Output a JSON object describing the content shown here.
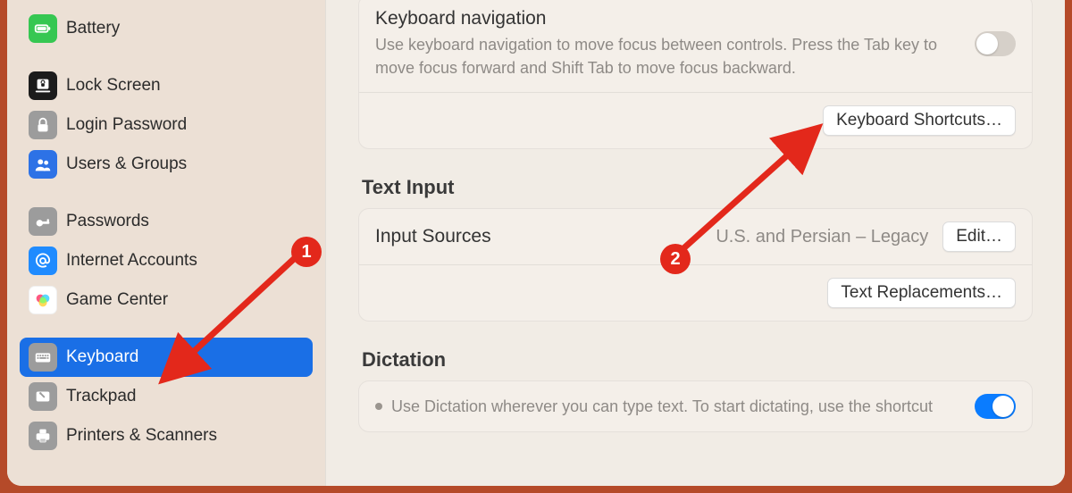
{
  "sidebar": {
    "items": [
      {
        "label": "Battery",
        "icon": "battery",
        "iconBg": "#36c752",
        "selected": false
      },
      {
        "label": "Lock Screen",
        "icon": "lock-screen",
        "iconBg": "#1c1c1c",
        "selected": false
      },
      {
        "label": "Login Password",
        "icon": "lock",
        "iconBg": "#9c9c9c",
        "selected": false
      },
      {
        "label": "Users & Groups",
        "icon": "users",
        "iconBg": "#2d72e6",
        "selected": false
      },
      {
        "label": "Passwords",
        "icon": "key",
        "iconBg": "#9c9c9c",
        "selected": false
      },
      {
        "label": "Internet Accounts",
        "icon": "at",
        "iconBg": "#1f8bff",
        "selected": false
      },
      {
        "label": "Game Center",
        "icon": "game-center",
        "iconBg": "#ffffff",
        "selected": false
      },
      {
        "label": "Keyboard",
        "icon": "keyboard",
        "iconBg": "#9c9c9c",
        "selected": true
      },
      {
        "label": "Trackpad",
        "icon": "trackpad",
        "iconBg": "#9c9c9c",
        "selected": false
      },
      {
        "label": "Printers & Scanners",
        "icon": "printer",
        "iconBg": "#9c9c9c",
        "selected": false
      }
    ]
  },
  "keyboard_nav": {
    "title": "Keyboard navigation",
    "desc": "Use keyboard navigation to move focus between controls. Press the Tab key to move focus forward and Shift Tab to move focus backward.",
    "shortcuts_button": "Keyboard Shortcuts…",
    "toggle_on": false
  },
  "text_input": {
    "section_title": "Text Input",
    "input_sources_label": "Input Sources",
    "input_sources_value": "U.S. and Persian – Legacy",
    "edit_button": "Edit…",
    "replacements_button": "Text Replacements…"
  },
  "dictation": {
    "section_title": "Dictation",
    "desc": "Use Dictation wherever you can type text. To start dictating, use the shortcut",
    "toggle_on": true
  },
  "annotations": {
    "b1": "1",
    "b2": "2"
  }
}
